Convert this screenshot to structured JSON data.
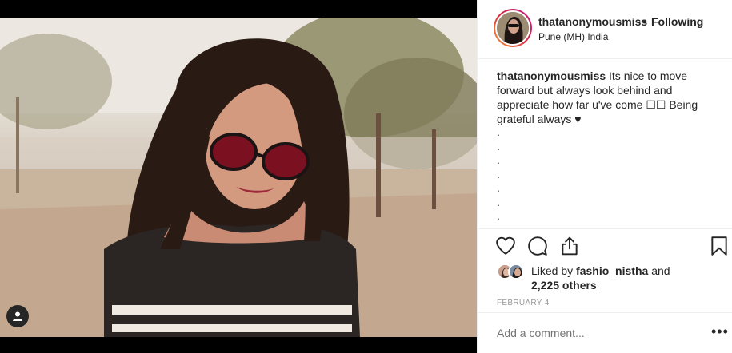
{
  "post": {
    "username": "thatanonymousmiss",
    "separator": "•",
    "follow_state": "Following",
    "location": "Pune (MH) India",
    "caption_text": "Its nice to move forward but always look behind and appreciate how far u've come ☐☐ Being grateful always ♥",
    "caption_dots": [
      ".",
      ".",
      ".",
      ".",
      ".",
      ".",
      "."
    ],
    "likes_prefix": "Liked by",
    "likes_user": "fashio_nistha",
    "likes_and": "and",
    "likes_count": "2,225 others",
    "date": "FEBRUARY 4",
    "comment_placeholder": "Add a comment...",
    "more_icon": "•••"
  },
  "icons": {
    "like": "heart-outline-icon",
    "comment": "speech-bubble-icon",
    "share": "share-upload-icon",
    "save": "bookmark-icon",
    "tag": "user-tag-icon"
  }
}
